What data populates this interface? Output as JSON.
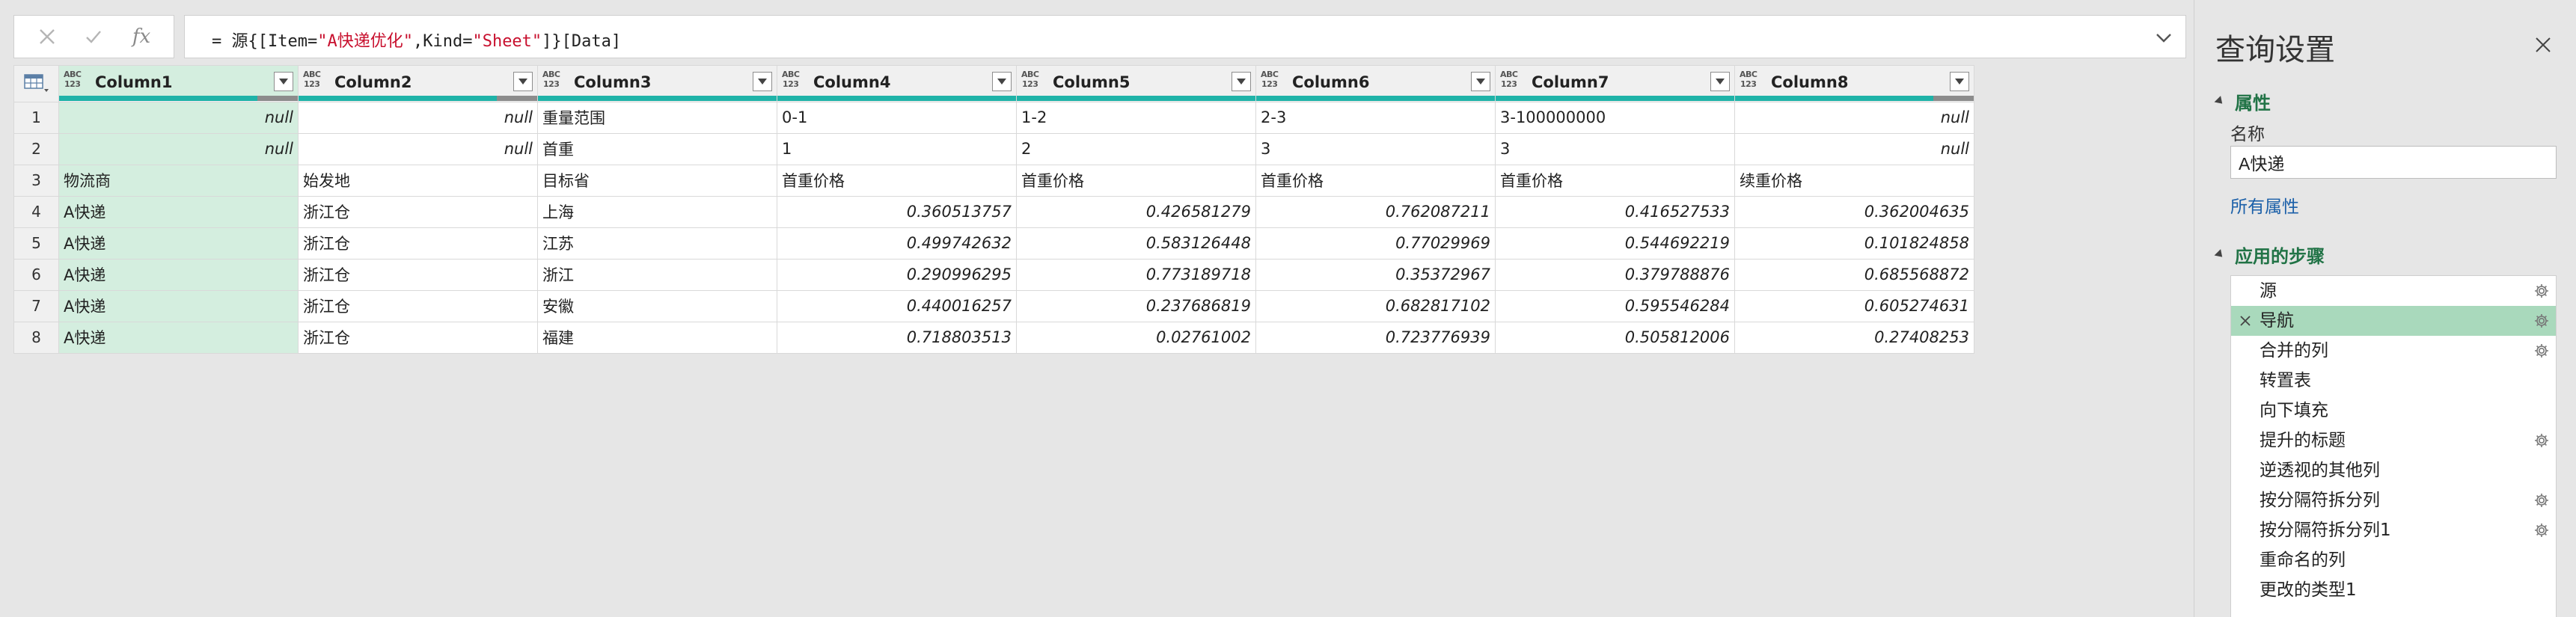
{
  "formula_bar": {
    "fx_label": "fx",
    "formula_prefix": "= 源{[Item=",
    "formula_item_value": "\"A快递优化\"",
    "formula_mid": ",Kind=",
    "formula_kind_value": "\"Sheet\"",
    "formula_suffix": "]}[Data]"
  },
  "grid": {
    "type_badge_top": "ABC",
    "type_badge_bottom": "123",
    "columns": [
      "Column1",
      "Column2",
      "Column3",
      "Column4",
      "Column5",
      "Column6",
      "Column7",
      "Column8"
    ],
    "quality": [
      {
        "valid": 0.83,
        "error": 0.17
      },
      {
        "valid": 0.83,
        "error": 0.17
      },
      {
        "valid": 1.0,
        "error": 0.0
      },
      {
        "valid": 1.0,
        "error": 0.0
      },
      {
        "valid": 1.0,
        "error": 0.0
      },
      {
        "valid": 1.0,
        "error": 0.0
      },
      {
        "valid": 1.0,
        "error": 0.0
      },
      {
        "valid": 0.83,
        "error": 0.17
      }
    ],
    "rows": [
      {
        "num": "1",
        "cells": [
          "null",
          "null",
          "重量范围",
          "0-1",
          "1-2",
          "2-3",
          "3-100000000",
          "null"
        ]
      },
      {
        "num": "2",
        "cells": [
          "null",
          "null",
          "首重",
          "1",
          "2",
          "3",
          "3",
          "null"
        ]
      },
      {
        "num": "3",
        "cells": [
          "物流商",
          "始发地",
          "目标省",
          "首重价格",
          "首重价格",
          "首重价格",
          "首重价格",
          "续重价格"
        ]
      },
      {
        "num": "4",
        "cells": [
          "A快递",
          "浙江仓",
          "上海",
          "0.360513757",
          "0.426581279",
          "0.762087211",
          "0.416527533",
          "0.362004635"
        ]
      },
      {
        "num": "5",
        "cells": [
          "A快递",
          "浙江仓",
          "江苏",
          "0.499742632",
          "0.583126448",
          "0.77029969",
          "0.544692219",
          "0.101824858"
        ]
      },
      {
        "num": "6",
        "cells": [
          "A快递",
          "浙江仓",
          "浙江",
          "0.290996295",
          "0.773189718",
          "0.35372967",
          "0.379788876",
          "0.685568872"
        ]
      },
      {
        "num": "7",
        "cells": [
          "A快递",
          "浙江仓",
          "安徽",
          "0.440016257",
          "0.237686819",
          "0.682817102",
          "0.595546284",
          "0.605274631"
        ]
      },
      {
        "num": "8",
        "cells": [
          "A快递",
          "浙江仓",
          "福建",
          "0.718803513",
          "0.02761002",
          "0.723776939",
          "0.505812006",
          "0.27408253"
        ]
      }
    ],
    "cell_styles": [
      [
        "null",
        "null",
        "text",
        "text",
        "text",
        "text",
        "text",
        "null"
      ],
      [
        "null",
        "null",
        "text",
        "text",
        "text",
        "text",
        "text",
        "null"
      ],
      [
        "text",
        "text",
        "text",
        "text",
        "text",
        "text",
        "text",
        "text"
      ],
      [
        "text",
        "text",
        "text",
        "num",
        "num",
        "num",
        "num",
        "num"
      ],
      [
        "text",
        "text",
        "text",
        "num",
        "num",
        "num",
        "num",
        "num"
      ],
      [
        "text",
        "text",
        "text",
        "num",
        "num",
        "num",
        "num",
        "num"
      ],
      [
        "text",
        "text",
        "text",
        "num",
        "num",
        "num",
        "num",
        "num"
      ],
      [
        "text",
        "text",
        "text",
        "num",
        "num",
        "num",
        "num",
        "num"
      ]
    ]
  },
  "side_panel": {
    "title": "查询设置",
    "properties_header": "属性",
    "name_label": "名称",
    "name_value": "A快递",
    "all_properties_link": "所有属性",
    "steps_header": "应用的步骤",
    "steps": [
      {
        "label": "源",
        "gear": true,
        "selected": false
      },
      {
        "label": "导航",
        "gear": true,
        "selected": true
      },
      {
        "label": "合并的列",
        "gear": true,
        "selected": false
      },
      {
        "label": "转置表",
        "gear": false,
        "selected": false
      },
      {
        "label": "向下填充",
        "gear": false,
        "selected": false
      },
      {
        "label": "提升的标题",
        "gear": true,
        "selected": false
      },
      {
        "label": "逆透视的其他列",
        "gear": false,
        "selected": false
      },
      {
        "label": "按分隔符拆分列",
        "gear": true,
        "selected": false
      },
      {
        "label": "按分隔符拆分列1",
        "gear": true,
        "selected": false
      },
      {
        "label": "重命名的列",
        "gear": false,
        "selected": false
      },
      {
        "label": "更改的类型1",
        "gear": false,
        "selected": false
      }
    ]
  },
  "colors": {
    "accent_green": "#217346",
    "selected_step": "#a9d9bc",
    "selected_column": "#d4eedf",
    "quality_valid": "#1fb3a8",
    "quality_error": "#8c8c8c",
    "link_blue": "#1a5fa8",
    "formula_string": "#c8102e"
  }
}
